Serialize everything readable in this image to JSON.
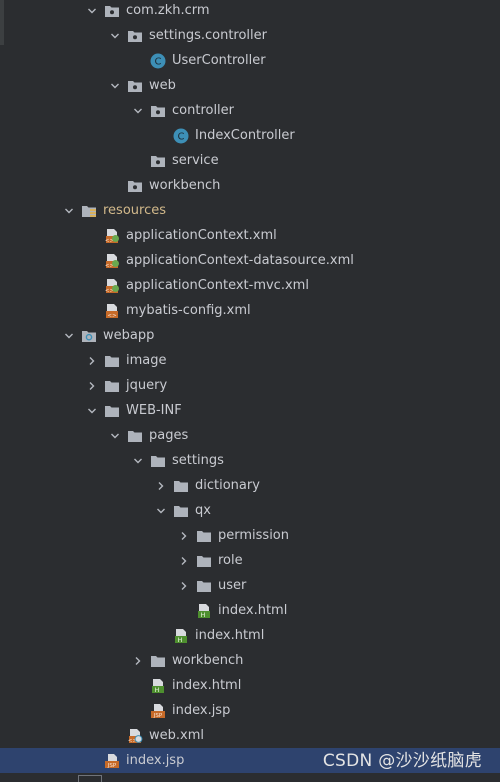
{
  "tree": [
    {
      "label": "com.zkh.crm",
      "icon": "package",
      "indent": 105,
      "arrow": "down"
    },
    {
      "label": "settings.controller",
      "icon": "package",
      "indent": 128,
      "arrow": "down"
    },
    {
      "label": "UserController",
      "icon": "class",
      "indent": 151,
      "arrow": "none"
    },
    {
      "label": "web",
      "icon": "package",
      "indent": 128,
      "arrow": "down"
    },
    {
      "label": "controller",
      "icon": "package",
      "indent": 151,
      "arrow": "down"
    },
    {
      "label": "IndexController",
      "icon": "class",
      "indent": 174,
      "arrow": "none"
    },
    {
      "label": "service",
      "icon": "package",
      "indent": 151,
      "arrow": "none"
    },
    {
      "label": "workbench",
      "icon": "package",
      "indent": 128,
      "arrow": "none"
    },
    {
      "label": "resources",
      "icon": "resources-folder",
      "indent": 82,
      "arrow": "down"
    },
    {
      "label": "applicationContext.xml",
      "icon": "spring-xml",
      "indent": 105,
      "arrow": "none"
    },
    {
      "label": "applicationContext-datasource.xml",
      "icon": "spring-xml",
      "indent": 105,
      "arrow": "none"
    },
    {
      "label": "applicationContext-mvc.xml",
      "icon": "spring-xml",
      "indent": 105,
      "arrow": "none"
    },
    {
      "label": "mybatis-config.xml",
      "icon": "xml",
      "indent": 105,
      "arrow": "none"
    },
    {
      "label": "webapp",
      "icon": "web-folder",
      "indent": 82,
      "arrow": "down"
    },
    {
      "label": "image",
      "icon": "folder",
      "indent": 105,
      "arrow": "right"
    },
    {
      "label": "jquery",
      "icon": "folder",
      "indent": 105,
      "arrow": "right"
    },
    {
      "label": "WEB-INF",
      "icon": "folder",
      "indent": 105,
      "arrow": "down"
    },
    {
      "label": "pages",
      "icon": "folder",
      "indent": 128,
      "arrow": "down"
    },
    {
      "label": "settings",
      "icon": "folder",
      "indent": 151,
      "arrow": "down"
    },
    {
      "label": "dictionary",
      "icon": "folder",
      "indent": 174,
      "arrow": "right"
    },
    {
      "label": "qx",
      "icon": "folder",
      "indent": 174,
      "arrow": "down"
    },
    {
      "label": "permission",
      "icon": "folder",
      "indent": 197,
      "arrow": "right"
    },
    {
      "label": "role",
      "icon": "folder",
      "indent": 197,
      "arrow": "right"
    },
    {
      "label": "user",
      "icon": "folder",
      "indent": 197,
      "arrow": "right"
    },
    {
      "label": "index.html",
      "icon": "html",
      "indent": 197,
      "arrow": "none"
    },
    {
      "label": "index.html",
      "icon": "html",
      "indent": 174,
      "arrow": "none"
    },
    {
      "label": "workbench",
      "icon": "folder",
      "indent": 151,
      "arrow": "right"
    },
    {
      "label": "index.html",
      "icon": "html",
      "indent": 151,
      "arrow": "none"
    },
    {
      "label": "index.jsp",
      "icon": "jsp",
      "indent": 151,
      "arrow": "none"
    },
    {
      "label": "web.xml",
      "icon": "web-xml",
      "indent": 128,
      "arrow": "none"
    },
    {
      "label": "index.jsp",
      "icon": "jsp",
      "indent": 105,
      "arrow": "none",
      "selected": true
    }
  ],
  "watermark": "CSDN @沙沙纸脑虎",
  "colors": {
    "background": "#2b2d30",
    "selection": "#2e436e",
    "text": "#c9cbd1",
    "resources_label": "#d2b98b",
    "class_icon": "#3d8fb6",
    "html_icon": "#4e8f2f",
    "jsp_icon": "#c66a28",
    "spring_leaf": "#6aa84f"
  }
}
